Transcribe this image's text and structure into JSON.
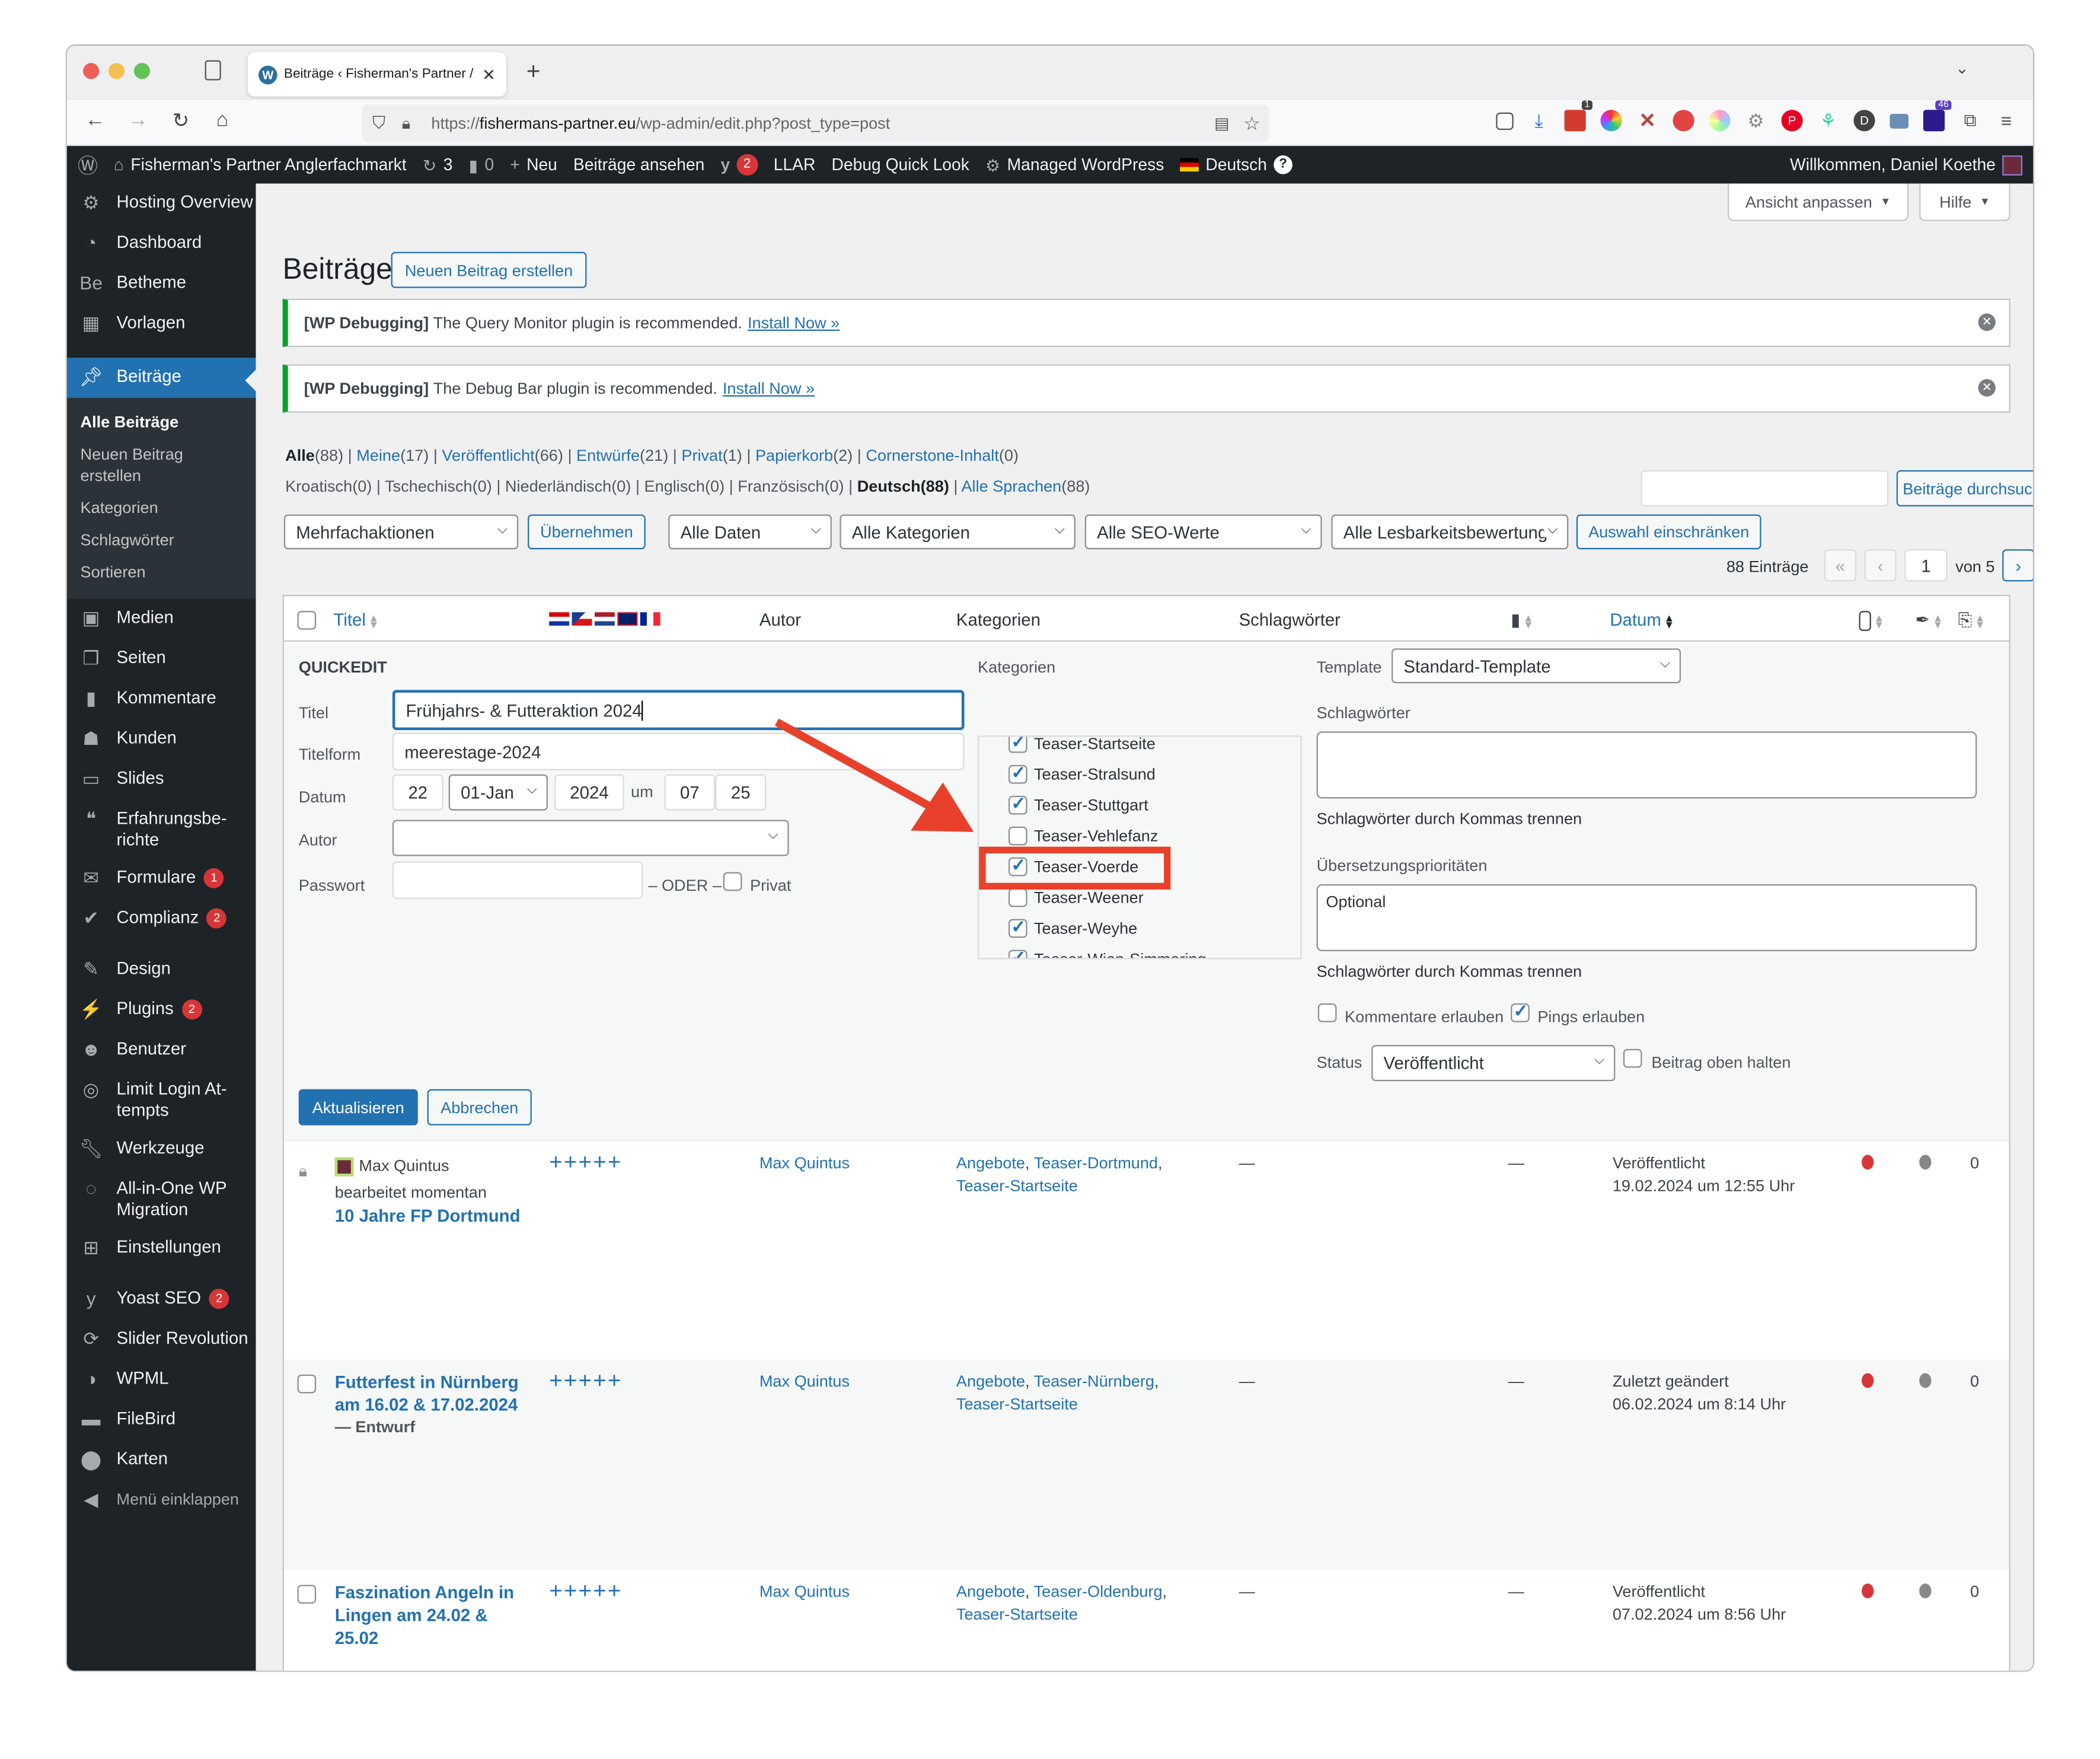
{
  "browser": {
    "tab_title": "Beiträge ‹ Fisherman's Partner /",
    "url_prefix": "https://",
    "url_host": "fishermans-partner.eu",
    "url_path": "/wp-admin/edit.php?post_type=post",
    "extension_badges": {
      "ext1": "1",
      "ext2": "46"
    }
  },
  "adminbar": {
    "site_name": "Fisherman's Partner Anglerfachmarkt",
    "updates_count": "3",
    "comments_count": "0",
    "new_label": "Neu",
    "view_posts": "Beiträge ansehen",
    "yoast_badge": "2",
    "llar": "LLAR",
    "debug_quick_look": "Debug Quick Look",
    "managed_wp": "Managed WordPress",
    "language": "Deutsch",
    "help_icon": "?",
    "welcome": "Willkommen, Daniel Koethe"
  },
  "sidebar": {
    "items": [
      {
        "label": "Hosting Overview",
        "icon": "gear-icon"
      },
      {
        "label": "Dashboard",
        "icon": "dashboard-icon"
      },
      {
        "label": "Betheme",
        "icon": "betheme-icon"
      },
      {
        "label": "Vorlagen",
        "icon": "templates-icon"
      },
      {
        "label": "Beiträge",
        "icon": "pin-icon"
      },
      {
        "label": "Medien",
        "icon": "media-icon"
      },
      {
        "label": "Seiten",
        "icon": "pages-icon"
      },
      {
        "label": "Kommentare",
        "icon": "comment-icon"
      },
      {
        "label": "Kunden",
        "icon": "customers-icon"
      },
      {
        "label": "Slides",
        "icon": "slides-icon"
      },
      {
        "label": "Erfahrungsbe-richte",
        "icon": "quote-icon"
      },
      {
        "label": "Formulare",
        "icon": "mail-icon",
        "badge": "1"
      },
      {
        "label": "Complianz",
        "icon": "check-icon",
        "badge": "2"
      },
      {
        "label": "Design",
        "icon": "brush-icon"
      },
      {
        "label": "Plugins",
        "icon": "plugin-icon",
        "badge": "2"
      },
      {
        "label": "Benutzer",
        "icon": "user-icon"
      },
      {
        "label": "Limit Login At-tempts",
        "icon": "fingerprint-icon"
      },
      {
        "label": "Werkzeuge",
        "icon": "wrench-icon"
      },
      {
        "label": "All-in-One WP Migration",
        "icon": "migration-icon"
      },
      {
        "label": "Einstellungen",
        "icon": "settings-icon"
      },
      {
        "label": "Yoast SEO",
        "icon": "yoast-icon",
        "badge": "2"
      },
      {
        "label": "Slider Revolution",
        "icon": "refresh-icon"
      },
      {
        "label": "WPML",
        "icon": "wpml-icon"
      },
      {
        "label": "FileBird",
        "icon": "folder-icon"
      },
      {
        "label": "Karten",
        "icon": "map-pin-icon"
      }
    ],
    "submenu": [
      "Alle Beiträge",
      "Neuen Beitrag erstellen",
      "Kategorien",
      "Schlagwörter",
      "Sortieren"
    ],
    "collapse": "Menü einklappen"
  },
  "page": {
    "title": "Beiträge",
    "add_new": "Neuen Beitrag erstellen",
    "screen_options": "Ansicht anpassen",
    "help": "Hilfe"
  },
  "notices": [
    {
      "prefix": "[WP Debugging]",
      "text": "The Query Monitor plugin is recommended.",
      "link": "Install Now »"
    },
    {
      "prefix": "[WP Debugging]",
      "text": "The Debug Bar plugin is recommended.",
      "link": "Install Now »"
    }
  ],
  "status_filters": [
    {
      "label": "Alle",
      "count": "(88)",
      "current": true
    },
    {
      "label": "Meine",
      "count": "(17)"
    },
    {
      "label": "Veröffentlicht",
      "count": "(66)"
    },
    {
      "label": "Entwürfe",
      "count": "(21)"
    },
    {
      "label": "Privat",
      "count": "(1)"
    },
    {
      "label": "Papierkorb",
      "count": "(2)"
    },
    {
      "label": "Cornerstone-Inhalt",
      "count": "(0)"
    }
  ],
  "language_filters": [
    {
      "label": "Kroatisch",
      "count": "(0)"
    },
    {
      "label": "Tschechisch",
      "count": "(0)"
    },
    {
      "label": "Niederländisch",
      "count": "(0)"
    },
    {
      "label": "Englisch",
      "count": "(0)"
    },
    {
      "label": "Französisch",
      "count": "(0)"
    },
    {
      "label": "Deutsch",
      "count": "(88)",
      "current": true
    },
    {
      "label": "Alle Sprachen",
      "count": "(88)",
      "link": true
    }
  ],
  "toolbar": {
    "bulk_actions": "Mehrfachaktionen",
    "apply": "Übernehmen",
    "dates": "Alle Daten",
    "categories": "Alle Kategorien",
    "seo": "Alle SEO-Werte",
    "readability": "Alle Lesbarkeitsbewertung",
    "filter": "Auswahl einschränken",
    "search_value": "",
    "search_button": "Beiträge durchsuchen",
    "items_count": "88 Einträge",
    "first": "«",
    "prev": "‹",
    "current_page": "1",
    "of_pages": "von 5",
    "next": "›",
    "last": "»"
  },
  "table": {
    "columns": {
      "title": "Titel",
      "author": "Autor",
      "categories": "Kategorien",
      "tags": "Schlagwörter",
      "date": "Datum"
    },
    "flags": [
      "Kroatisch",
      "Tschechisch",
      "Niederländisch",
      "Englisch",
      "Französisch"
    ]
  },
  "quickedit": {
    "heading": "QUICKEDIT",
    "title_label": "Titel",
    "title_value": "Frühjahrs- & Futteraktion 2024",
    "slug_label": "Titelform",
    "slug_value": "meerestage-2024",
    "date_label": "Datum",
    "day": "22",
    "month": "01-Jan",
    "year": "2024",
    "at": "um",
    "hour": "07",
    "colon": ":",
    "minute": "25",
    "author_label": "Autor",
    "author_value": "",
    "password_label": "Passwort",
    "password_value": "",
    "or": "– ODER –",
    "private_label": "Privat",
    "private_checked": false,
    "categories_label": "Kategorien",
    "categories": [
      {
        "label": "Teaser-Startseite",
        "checked": true
      },
      {
        "label": "Teaser-Stralsund",
        "checked": true
      },
      {
        "label": "Teaser-Stuttgart",
        "checked": true
      },
      {
        "label": "Teaser-Vehlefanz",
        "checked": false
      },
      {
        "label": "Teaser-Voerde",
        "checked": true,
        "highlighted": true
      },
      {
        "label": "Teaser-Weener",
        "checked": false
      },
      {
        "label": "Teaser-Weyhe",
        "checked": true
      },
      {
        "label": "Teaser-Wien-Simmering",
        "checked": true
      }
    ],
    "template_label": "Template",
    "template_value": "Standard-Template",
    "tags_label": "Schlagwörter",
    "tags_value": "",
    "tags_hint": "Schlagwörter durch Kommas trennen",
    "translation_label": "Übersetzungsprioritäten",
    "translation_value": "Optional",
    "translation_hint": "Schlagwörter durch Kommas trennen",
    "allow_comments": "Kommentare erlauben",
    "allow_comments_checked": false,
    "allow_pings": "Pings erlauben",
    "allow_pings_checked": true,
    "status_label": "Status",
    "status_value": "Veröffentlicht",
    "sticky_label": "Beitrag oben halten",
    "sticky_checked": false,
    "update_button": "Aktualisieren",
    "cancel_button": "Abbrechen"
  },
  "posts": [
    {
      "locked": true,
      "lock_user": "Max Quintus",
      "lock_text": "bearbeitet momentan",
      "title": "10 Jahre FP Dortmund",
      "state": "",
      "translations": "+++++",
      "author": "Max Quintus",
      "categories": [
        "Angebote",
        "Teaser-Dortmund",
        "Teaser-Startseite"
      ],
      "tags": "—",
      "comments": "—",
      "date_status": "Veröffentlicht",
      "date": "19.02.2024 um 12:55 Uhr",
      "seo_color": "#d63638",
      "readability_color": "#888888",
      "links": "0"
    },
    {
      "locked": false,
      "title": "Futterfest in Nürnberg am 16.02 & 17.02.2024",
      "state": "— Entwurf",
      "translations": "+++++",
      "author": "Max Quintus",
      "categories": [
        "Angebote",
        "Teaser-Nürnberg",
        "Teaser-Startseite"
      ],
      "tags": "—",
      "comments": "—",
      "date_status": "Zuletzt geändert",
      "date": "06.02.2024 um 8:14 Uhr",
      "seo_color": "#d63638",
      "readability_color": "#888888",
      "links": "0"
    },
    {
      "locked": false,
      "title": "Faszination Angeln in Lingen am 24.02 & 25.02",
      "state": "",
      "translations": "+++++",
      "author": "Max Quintus",
      "categories": [
        "Angebote",
        "Teaser-Oldenburg",
        "Teaser-Startseite"
      ],
      "tags": "—",
      "comments": "—",
      "date_status": "Veröffentlicht",
      "date": "07.02.2024 um 8:56 Uhr",
      "seo_color": "#d63638",
      "readability_color": "#888888",
      "links": "0"
    }
  ],
  "colors": {
    "accent": "#2271b1",
    "admin_dark": "#1d2327",
    "notice_green": "#00a32a",
    "annotation_red": "#e8412b",
    "badge_red": "#d63638"
  }
}
